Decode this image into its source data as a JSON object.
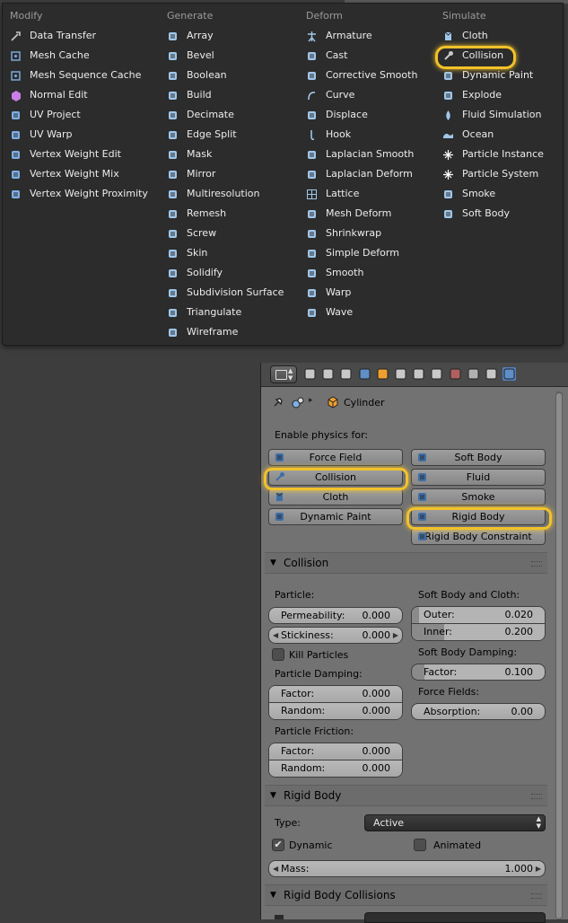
{
  "menu": {
    "columns": [
      {
        "header": "Modify",
        "items": [
          {
            "label": "Data Transfer",
            "icon": "data-transfer-icon",
            "color": "#c9c9c9"
          },
          {
            "label": "Mesh Cache",
            "icon": "mesh-cache-icon",
            "color": "#7fb0e6"
          },
          {
            "label": "Mesh Sequence Cache",
            "icon": "mesh-sequence-cache-icon",
            "color": "#7fb0e6"
          },
          {
            "label": "Normal Edit",
            "icon": "normal-edit-icon",
            "color": "#c97fe6"
          },
          {
            "label": "UV Project",
            "icon": "uv-project-icon",
            "color": "#7fb0e6"
          },
          {
            "label": "UV Warp",
            "icon": "uv-warp-icon",
            "color": "#7fb0e6"
          },
          {
            "label": "Vertex Weight Edit",
            "icon": "vertex-weight-edit-icon",
            "color": "#7fb0e6"
          },
          {
            "label": "Vertex Weight Mix",
            "icon": "vertex-weight-mix-icon",
            "color": "#7fb0e6"
          },
          {
            "label": "Vertex Weight Proximity",
            "icon": "vertex-weight-proximity-icon",
            "color": "#7fb0e6"
          }
        ]
      },
      {
        "header": "Generate",
        "items": [
          {
            "label": "Array",
            "icon": "array-icon",
            "color": "#9fc6ea"
          },
          {
            "label": "Bevel",
            "icon": "bevel-icon",
            "color": "#9fc6ea"
          },
          {
            "label": "Boolean",
            "icon": "boolean-icon",
            "color": "#9fc6ea"
          },
          {
            "label": "Build",
            "icon": "build-icon",
            "color": "#9fc6ea"
          },
          {
            "label": "Decimate",
            "icon": "decimate-icon",
            "color": "#9fc6ea"
          },
          {
            "label": "Edge Split",
            "icon": "edge-split-icon",
            "color": "#9fc6ea"
          },
          {
            "label": "Mask",
            "icon": "mask-icon",
            "color": "#9fc6ea"
          },
          {
            "label": "Mirror",
            "icon": "mirror-icon",
            "color": "#9fc6ea"
          },
          {
            "label": "Multiresolution",
            "icon": "multiresolution-icon",
            "color": "#9fc6ea"
          },
          {
            "label": "Remesh",
            "icon": "remesh-icon",
            "color": "#9fc6ea"
          },
          {
            "label": "Screw",
            "icon": "screw-icon",
            "color": "#9fc6ea"
          },
          {
            "label": "Skin",
            "icon": "skin-icon",
            "color": "#9fc6ea"
          },
          {
            "label": "Solidify",
            "icon": "solidify-icon",
            "color": "#9fc6ea"
          },
          {
            "label": "Subdivision Surface",
            "icon": "subdivision-surface-icon",
            "color": "#9fc6ea"
          },
          {
            "label": "Triangulate",
            "icon": "triangulate-icon",
            "color": "#9fc6ea"
          },
          {
            "label": "Wireframe",
            "icon": "wireframe-icon",
            "color": "#9fc6ea"
          }
        ]
      },
      {
        "header": "Deform",
        "items": [
          {
            "label": "Armature",
            "icon": "armature-icon",
            "color": "#9fc6ea"
          },
          {
            "label": "Cast",
            "icon": "cast-icon",
            "color": "#9fc6ea"
          },
          {
            "label": "Corrective Smooth",
            "icon": "corrective-smooth-icon",
            "color": "#9fc6ea"
          },
          {
            "label": "Curve",
            "icon": "curve-icon",
            "color": "#9fc6ea"
          },
          {
            "label": "Displace",
            "icon": "displace-icon",
            "color": "#9fc6ea"
          },
          {
            "label": "Hook",
            "icon": "hook-icon",
            "color": "#9fc6ea"
          },
          {
            "label": "Laplacian Smooth",
            "icon": "laplacian-smooth-icon",
            "color": "#9fc6ea"
          },
          {
            "label": "Laplacian Deform",
            "icon": "laplacian-deform-icon",
            "color": "#9fc6ea"
          },
          {
            "label": "Lattice",
            "icon": "lattice-icon",
            "color": "#9fc6ea"
          },
          {
            "label": "Mesh Deform",
            "icon": "mesh-deform-icon",
            "color": "#9fc6ea"
          },
          {
            "label": "Shrinkwrap",
            "icon": "shrinkwrap-icon",
            "color": "#9fc6ea"
          },
          {
            "label": "Simple Deform",
            "icon": "simple-deform-icon",
            "color": "#9fc6ea"
          },
          {
            "label": "Smooth",
            "icon": "smooth-icon",
            "color": "#9fc6ea"
          },
          {
            "label": "Warp",
            "icon": "warp-icon",
            "color": "#9fc6ea"
          },
          {
            "label": "Wave",
            "icon": "wave-icon",
            "color": "#9fc6ea"
          }
        ]
      },
      {
        "header": "Simulate",
        "items": [
          {
            "label": "Cloth",
            "icon": "cloth-icon",
            "color": "#9fc6ea"
          },
          {
            "label": "Collision",
            "icon": "collision-icon",
            "color": "#c9c9c9"
          },
          {
            "label": "Dynamic Paint",
            "icon": "dynamic-paint-icon",
            "color": "#9fc6ea"
          },
          {
            "label": "Explode",
            "icon": "explode-icon",
            "color": "#9fc6ea"
          },
          {
            "label": "Fluid Simulation",
            "icon": "fluid-simulation-icon",
            "color": "#9fc6ea"
          },
          {
            "label": "Ocean",
            "icon": "ocean-icon",
            "color": "#9fc6ea"
          },
          {
            "label": "Particle Instance",
            "icon": "particle-instance-icon",
            "color": "#ffffff"
          },
          {
            "label": "Particle System",
            "icon": "particle-system-icon",
            "color": "#ffffff"
          },
          {
            "label": "Smoke",
            "icon": "smoke-icon",
            "color": "#9fc6ea"
          },
          {
            "label": "Soft Body",
            "icon": "soft-body-icon",
            "color": "#9fc6ea"
          }
        ]
      }
    ],
    "highlight_color": "#f2c22a"
  },
  "props": {
    "tab_icons": [
      "render-icon",
      "render-layers-icon",
      "scene-icon",
      "world-icon",
      "object-icon",
      "constraints-icon",
      "modifiers-icon",
      "data-icon",
      "material-icon",
      "texture-icon",
      "particles-icon",
      "physics-icon"
    ],
    "context": {
      "object_name": "Cylinder"
    },
    "enable_physics_label": "Enable physics for:",
    "physics_buttons": [
      {
        "label": "Force Field",
        "icon": "force-field-icon"
      },
      {
        "label": "Soft Body",
        "icon": "soft-body-icon"
      },
      {
        "label": "Collision",
        "icon": "collision-icon"
      },
      {
        "label": "Fluid",
        "icon": "fluid-icon"
      },
      {
        "label": "Cloth",
        "icon": "cloth-icon"
      },
      {
        "label": "Smoke",
        "icon": "smoke-icon"
      },
      {
        "label": "Dynamic Paint",
        "icon": "dynamic-paint-icon"
      },
      {
        "label": "Rigid Body",
        "icon": "rigid-body-icon"
      },
      {
        "label": "Rigid Body Constraint",
        "icon": "rigid-body-constraint-icon"
      }
    ],
    "collision": {
      "title": "Collision",
      "particle_label": "Particle:",
      "permeability": {
        "label": "Permeability:",
        "value": "0.000"
      },
      "stickiness": {
        "label": "Stickiness:",
        "value": "0.000"
      },
      "kill_particles": "Kill Particles",
      "particle_damping_label": "Particle Damping:",
      "damping_factor": {
        "label": "Factor:",
        "value": "0.000"
      },
      "damping_random": {
        "label": "Random:",
        "value": "0.000"
      },
      "particle_friction_label": "Particle Friction:",
      "friction_factor": {
        "label": "Factor:",
        "value": "0.000"
      },
      "friction_random": {
        "label": "Random:",
        "value": "0.000"
      },
      "softbody_cloth_label": "Soft Body and Cloth:",
      "outer": {
        "label": "Outer:",
        "value": "0.020"
      },
      "inner": {
        "label": "Inner:",
        "value": "0.200"
      },
      "softbody_damping_label": "Soft Body Damping:",
      "sb_factor": {
        "label": "Factor:",
        "value": "0.100"
      },
      "force_fields_label": "Force Fields:",
      "absorption": {
        "label": "Absorption:",
        "value": "0.00"
      }
    },
    "rigid_body": {
      "title": "Rigid Body",
      "type_label": "Type:",
      "type_value": "Active",
      "dynamic": "Dynamic",
      "dynamic_checked": true,
      "animated": "Animated",
      "animated_checked": false,
      "mass": {
        "label": "Mass:",
        "value": "1.000"
      }
    },
    "rigid_body_collisions": {
      "title": "Rigid Body Collisions"
    }
  }
}
